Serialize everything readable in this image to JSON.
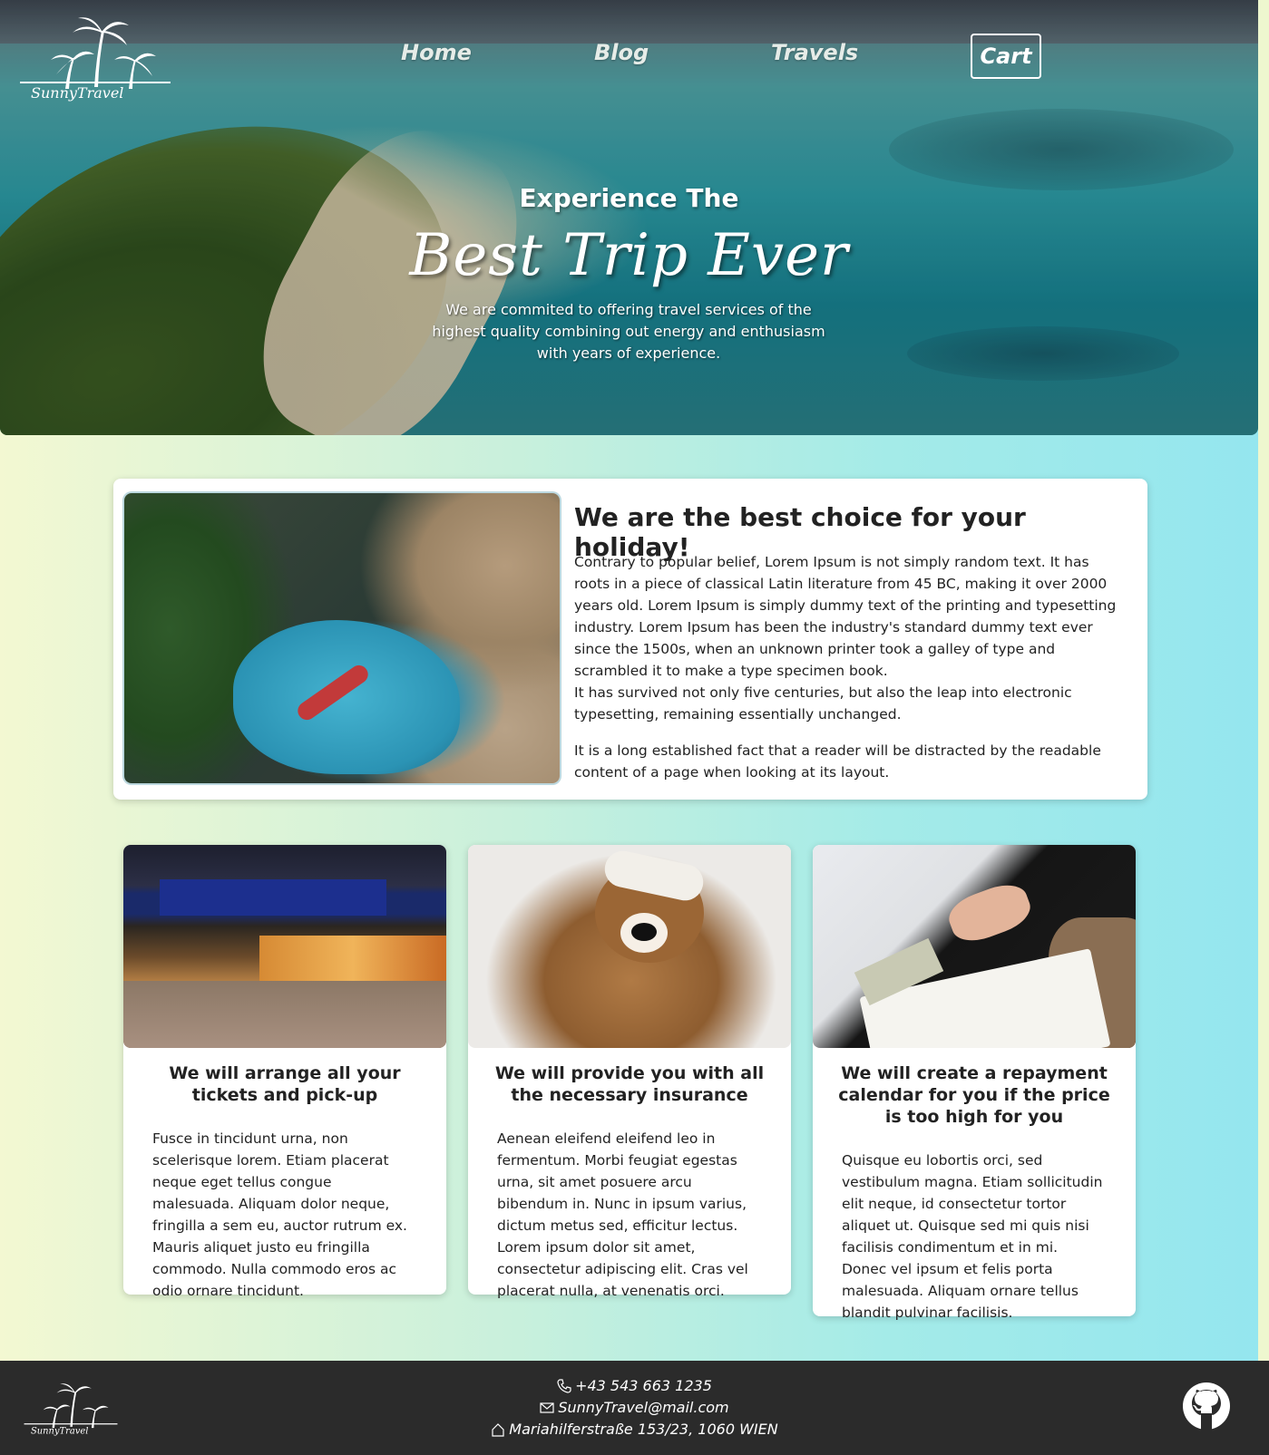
{
  "brand": {
    "name": "SunnyTravel"
  },
  "nav": {
    "home": "Home",
    "blog": "Blog",
    "travels": "Travels",
    "cart": "Cart"
  },
  "hero": {
    "pretitle": "Experience The",
    "title": "Best Trip Ever",
    "subtitle": "We are commited to offering travel services of the highest quality combining out energy and enthusiasm with years of experience."
  },
  "feature": {
    "title": "We are the best choice for your holiday!",
    "paragraphs": [
      "Contrary to popular belief, Lorem Ipsum is not simply random text. It has roots in a piece of classical Latin literature from 45 BC, making it over 2000 years old. Lorem Ipsum is simply dummy text of the printing and typesetting industry. Lorem Ipsum has been the industry's standard dummy text ever since the 1500s, when an unknown printer took a galley of type and scrambled it to make a type specimen book.",
      "It has survived not only five centuries, but also the leap into electronic typesetting, remaining essentially unchanged.",
      "It is a long established fact that a reader will be distracted by the readable content of a page when looking at its layout."
    ]
  },
  "cards": [
    {
      "title": "We will arrange all your tickets and pick-up",
      "body": "Fusce in tincidunt urna, non scelerisque lorem. Etiam placerat neque eget tellus congue malesuada. Aliquam dolor neque, fringilla a sem eu, auctor rutrum ex. Mauris aliquet justo eu fringilla commodo. Nulla commodo eros ac odio ornare tincidunt."
    },
    {
      "title": "We will provide you with all the necessary insurance",
      "body": "Aenean eleifend eleifend leo in fermentum. Morbi feugiat egestas urna, sit amet posuere arcu bibendum in. Nunc in ipsum varius, dictum metus sed, efficitur lectus. Lorem ipsum dolor sit amet, consectetur adipiscing elit. Cras vel placerat nulla, at venenatis orci."
    },
    {
      "title": "We will create a repayment calendar for you if the price is too high for you",
      "body": "Quisque eu lobortis orci, sed vestibulum magna. Etiam sollicitudin elit neque, id consectetur tortor aliquet ut. Quisque sed mi quis nisi facilisis condimentum et in mi. Donec vel ipsum et felis porta malesuada. Aliquam ornare tellus blandit pulvinar facilisis."
    }
  ],
  "footer": {
    "phone": "+43 543 663 1235",
    "email": "SunnyTravel@mail.com",
    "address": "Mariahilferstraße 153/23, 1060 WIEN"
  },
  "icons": {
    "phone": "phone-icon",
    "email": "envelope-icon",
    "address": "home-icon",
    "github": "github-icon"
  },
  "colors": {
    "footer_bg": "#2b2b2b",
    "card_bg": "#ffffff",
    "gradient_left": "#f3f8d2",
    "gradient_right": "#94e6ef"
  }
}
